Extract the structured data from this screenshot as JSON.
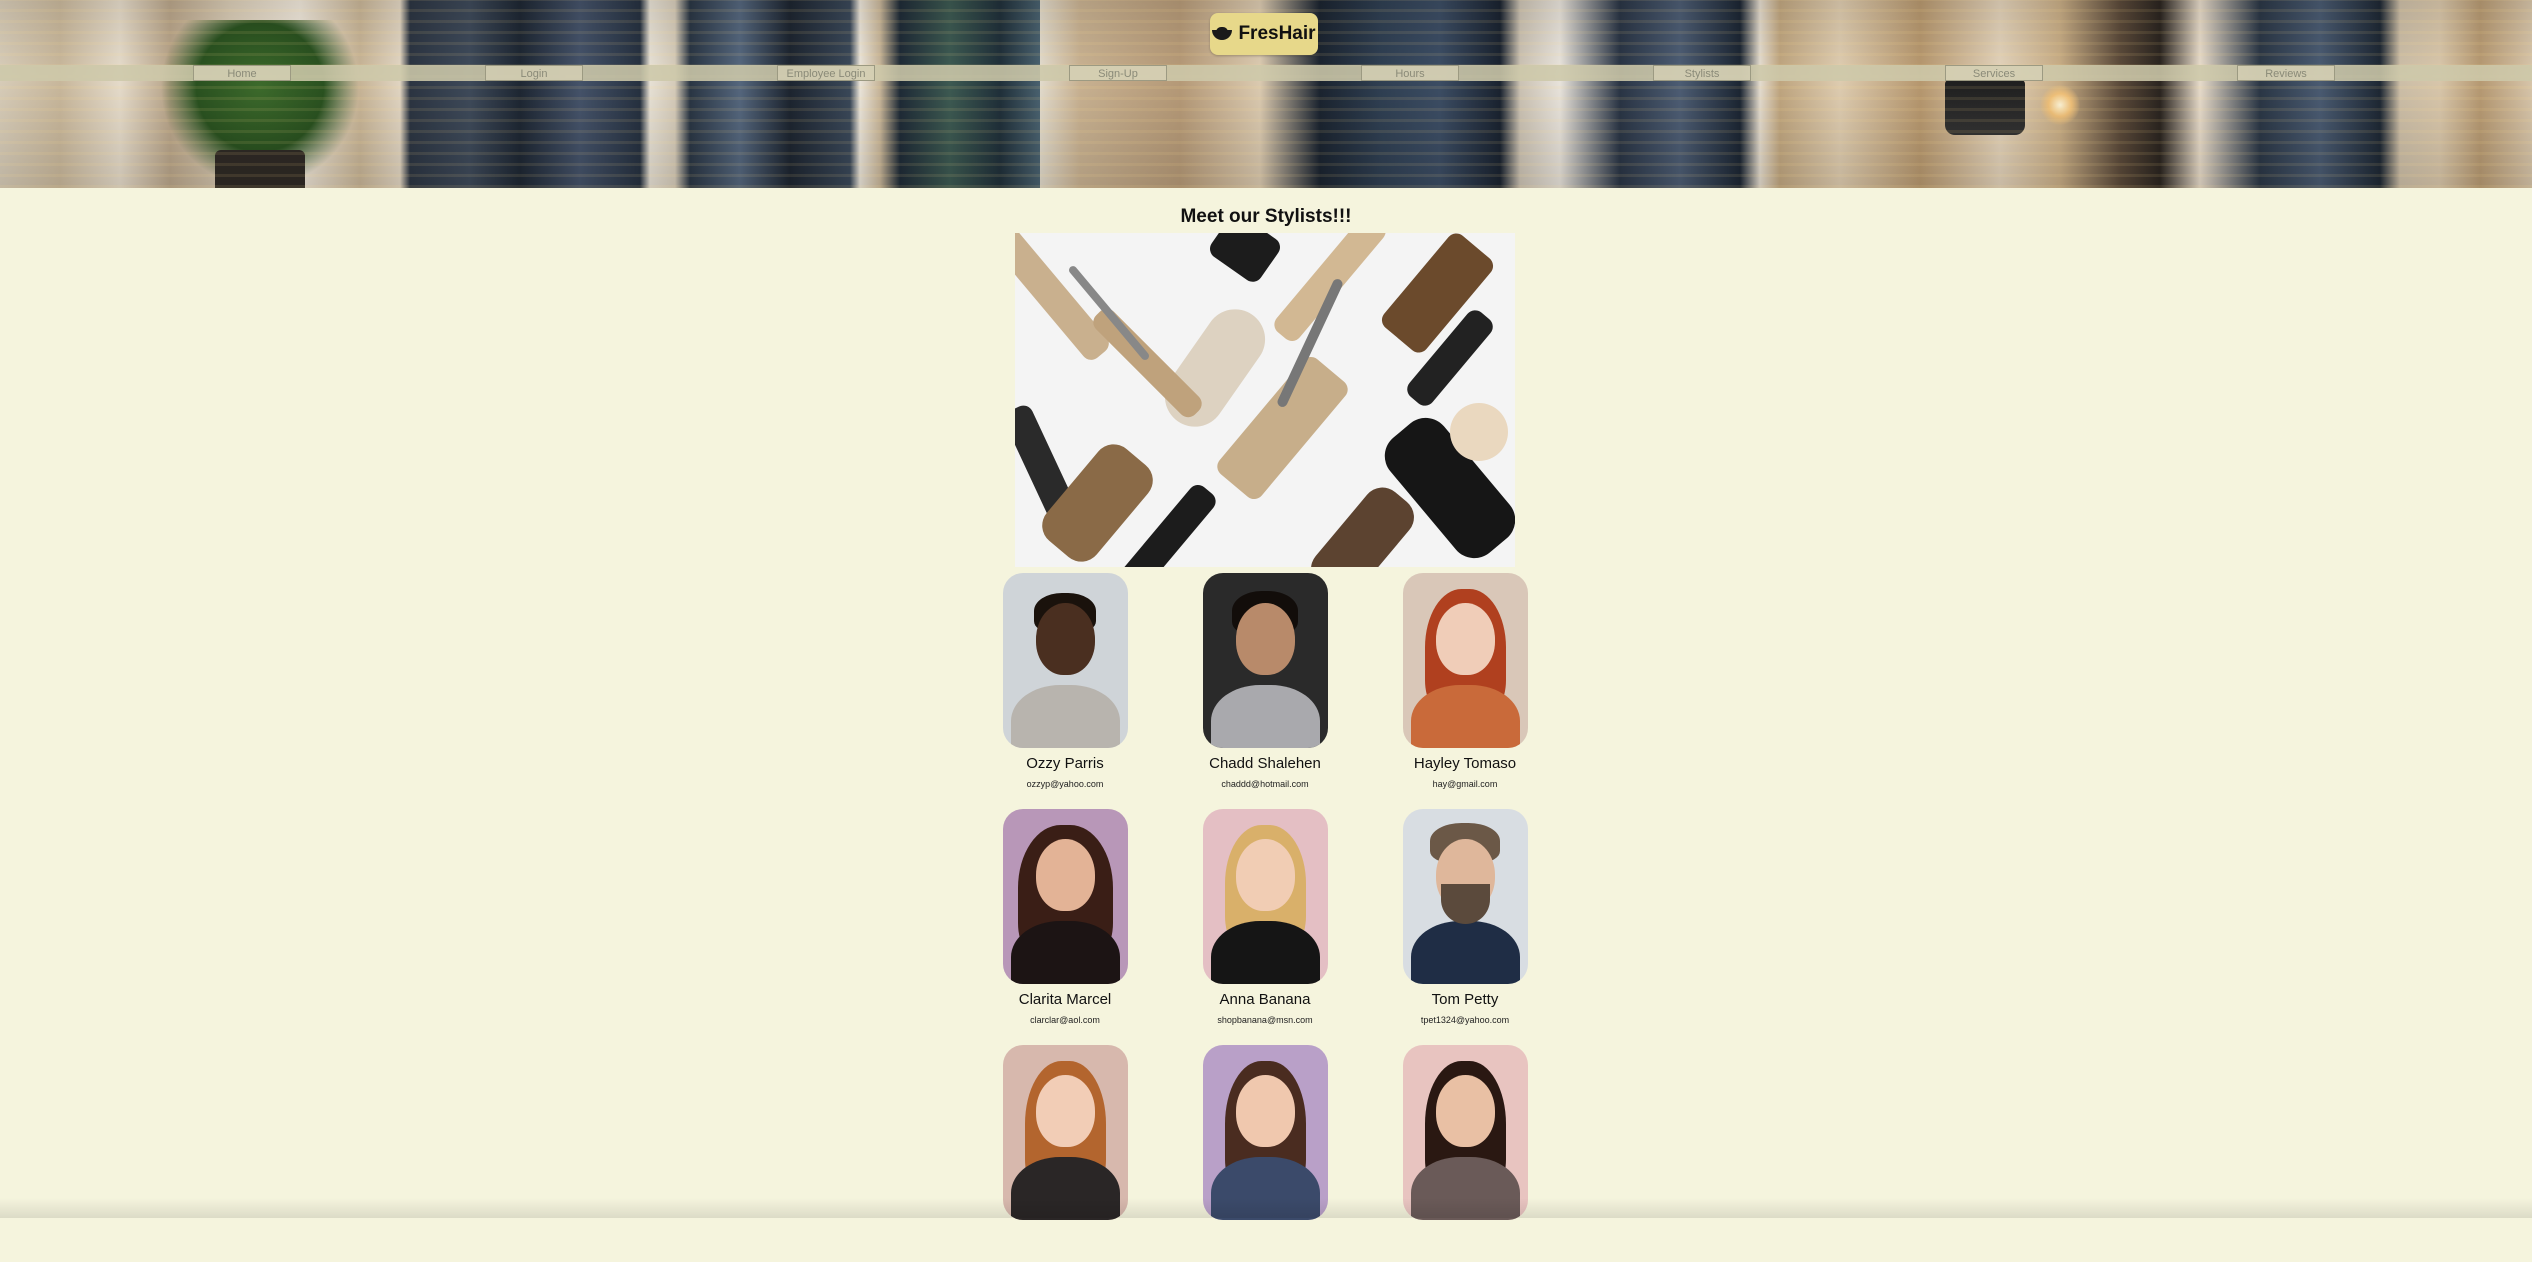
{
  "brand": {
    "name": "FresHair",
    "icon": "bowl-icon"
  },
  "nav": {
    "items": [
      {
        "label": "Home"
      },
      {
        "label": "Login"
      },
      {
        "label": "Employee Login"
      },
      {
        "label": "Sign-Up"
      },
      {
        "label": "Hours"
      },
      {
        "label": "Stylists"
      },
      {
        "label": "Services"
      },
      {
        "label": "Reviews"
      }
    ]
  },
  "main": {
    "title": "Meet our Stylists!!!"
  },
  "stylists": [
    {
      "name": "Ozzy Parris",
      "email": "ozzyp@yahoo.com"
    },
    {
      "name": "Chadd Shalehen",
      "email": "chaddd@hotmail.com"
    },
    {
      "name": "Hayley Tomaso",
      "email": "hay@gmail.com"
    },
    {
      "name": "Clarita Marcel",
      "email": "clarclar@aol.com"
    },
    {
      "name": "Anna Banana",
      "email": "shopbanana@msn.com"
    },
    {
      "name": "Tom Petty",
      "email": "tpet1324@yahoo.com"
    },
    {
      "name": "",
      "email": ""
    },
    {
      "name": "",
      "email": ""
    },
    {
      "name": "",
      "email": ""
    }
  ],
  "colors": {
    "page_background": "#f5f4dd",
    "logo_background": "#e7d88a",
    "nav_bar": "#cdc8aa"
  }
}
